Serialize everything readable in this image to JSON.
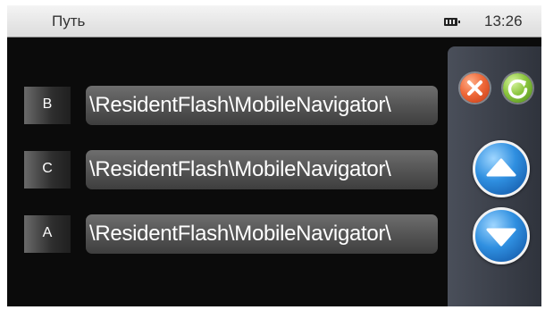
{
  "statusbar": {
    "title": "Путь",
    "time": "13:26",
    "battery_icon": "battery-icon"
  },
  "paths": [
    {
      "drive": "B",
      "path": "\\ResidentFlash\\MobileNavigator\\"
    },
    {
      "drive": "C",
      "path": "\\ResidentFlash\\MobileNavigator\\"
    },
    {
      "drive": "A",
      "path": "\\ResidentFlash\\MobileNavigator\\"
    }
  ],
  "side_panel": {
    "cancel_icon": "close-icon",
    "refresh_icon": "refresh-icon",
    "up_icon": "arrow-up-icon",
    "down_icon": "arrow-down-icon"
  },
  "colors": {
    "statusbar_bg": "#e6e6e6",
    "screen_bg": "#0b0b0b",
    "cancel": "#ef6a3a",
    "refresh": "#8cc63f",
    "arrow_buttons": "#2f8fe0"
  }
}
